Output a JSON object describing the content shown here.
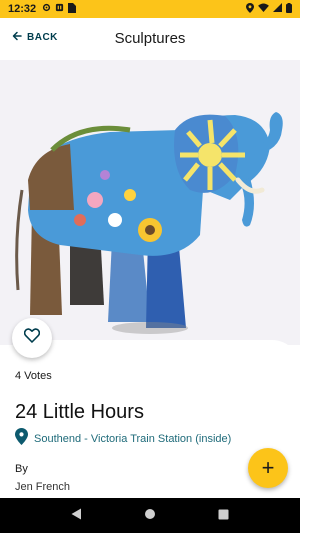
{
  "status_bar": {
    "time": "12:32",
    "icons": [
      "settings-icon",
      "pause-icon",
      "sim-card-icon",
      "location-icon",
      "wifi-icon",
      "signal-icon",
      "battery-icon"
    ]
  },
  "app_bar": {
    "back_label": "BACK",
    "title": "Sculptures"
  },
  "sculpture": {
    "votes": "4 Votes",
    "title": "24 Little Hours",
    "location": "Southend - Victoria Train Station (inside)",
    "by_label": "By",
    "artist": "Jen French",
    "image_icon": "elephant-sculpture-image"
  },
  "actions": {
    "vote_icon": "heart-outline-icon",
    "fab_icon": "plus-icon",
    "fab_label": "+"
  },
  "nav": [
    "back-triangle-icon",
    "home-circle-icon",
    "recents-square-icon"
  ],
  "colors": {
    "accent": "#fcc419",
    "location_text": "#1f6b7a",
    "back_text": "#003d4d"
  }
}
